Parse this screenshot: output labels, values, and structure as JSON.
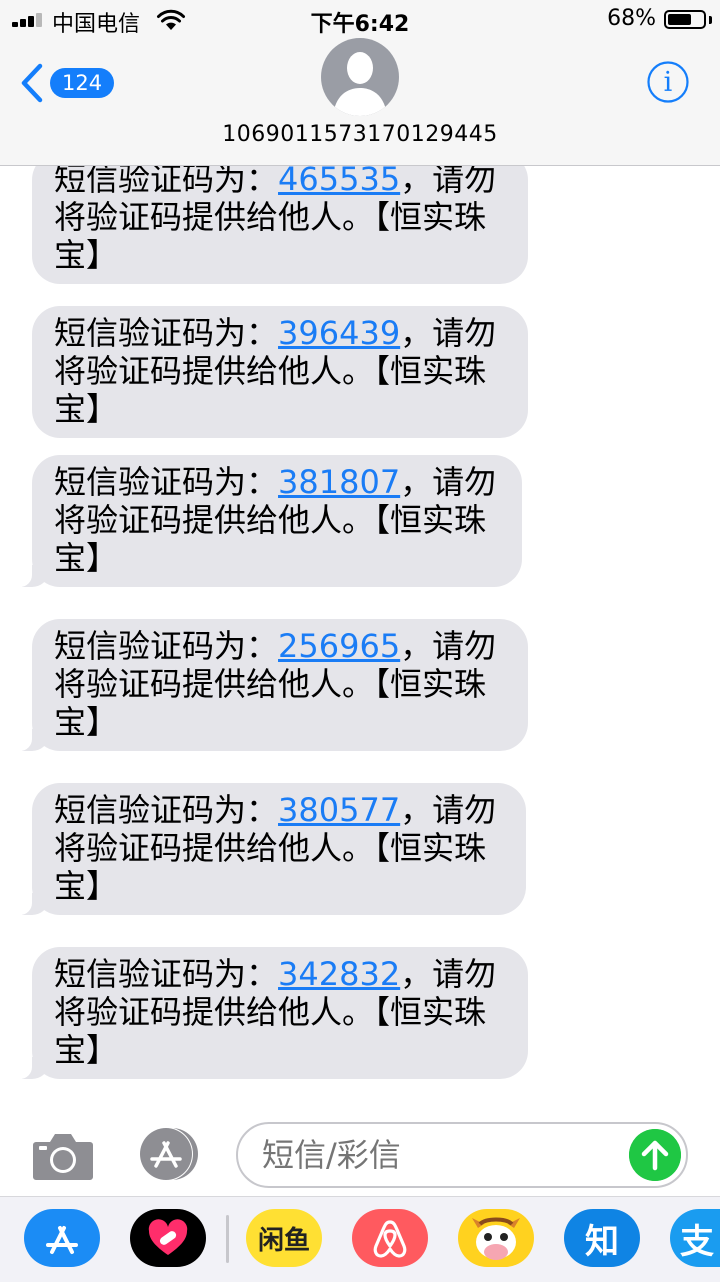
{
  "status_bar": {
    "carrier": "中国电信",
    "time": "下午6:42",
    "battery": "68%",
    "battery_level": 0.68
  },
  "header": {
    "back_count": "124",
    "contact": "1069011573170129445"
  },
  "messages": [
    {
      "prefix": "短信验证码为：",
      "code": "465535",
      "suffix": "，请勿将验证码提供给他人。【恒实珠宝】"
    },
    {
      "prefix": "短信验证码为：",
      "code": "396439",
      "suffix": "，请勿将验证码提供给他人。【恒实珠宝】"
    },
    {
      "prefix": "短信验证码为：",
      "code": "381807",
      "suffix": "，请勿将验证码提供给他人。【恒实珠宝】"
    },
    {
      "prefix": "短信验证码为：",
      "code": "256965",
      "suffix": "，请勿将验证码提供给他人。【恒实珠宝】"
    },
    {
      "prefix": "短信验证码为：",
      "code": "380577",
      "suffix": "，请勿将验证码提供给他人。【恒实珠宝】"
    },
    {
      "prefix": "短信验证码为：",
      "code": "342832",
      "suffix": "，请勿将验证码提供给他人。【恒实珠宝】"
    }
  ],
  "compose": {
    "placeholder": "短信/彩信"
  },
  "app_drawer": {
    "apps": [
      {
        "icon": "app-store-icon"
      },
      {
        "icon": "health-heart-icon"
      },
      {
        "icon": "xianyu-icon",
        "label": "闲鱼"
      },
      {
        "icon": "airbnb-icon"
      },
      {
        "icon": "mascot-icon"
      },
      {
        "icon": "zhihu-icon",
        "label": "知"
      },
      {
        "icon": "alipay-icon",
        "label": "支"
      }
    ]
  },
  "colors": {
    "accent": "#147efb",
    "bubble": "#e5e5ea",
    "link": "#1a7cf5",
    "send": "#1fc744"
  }
}
